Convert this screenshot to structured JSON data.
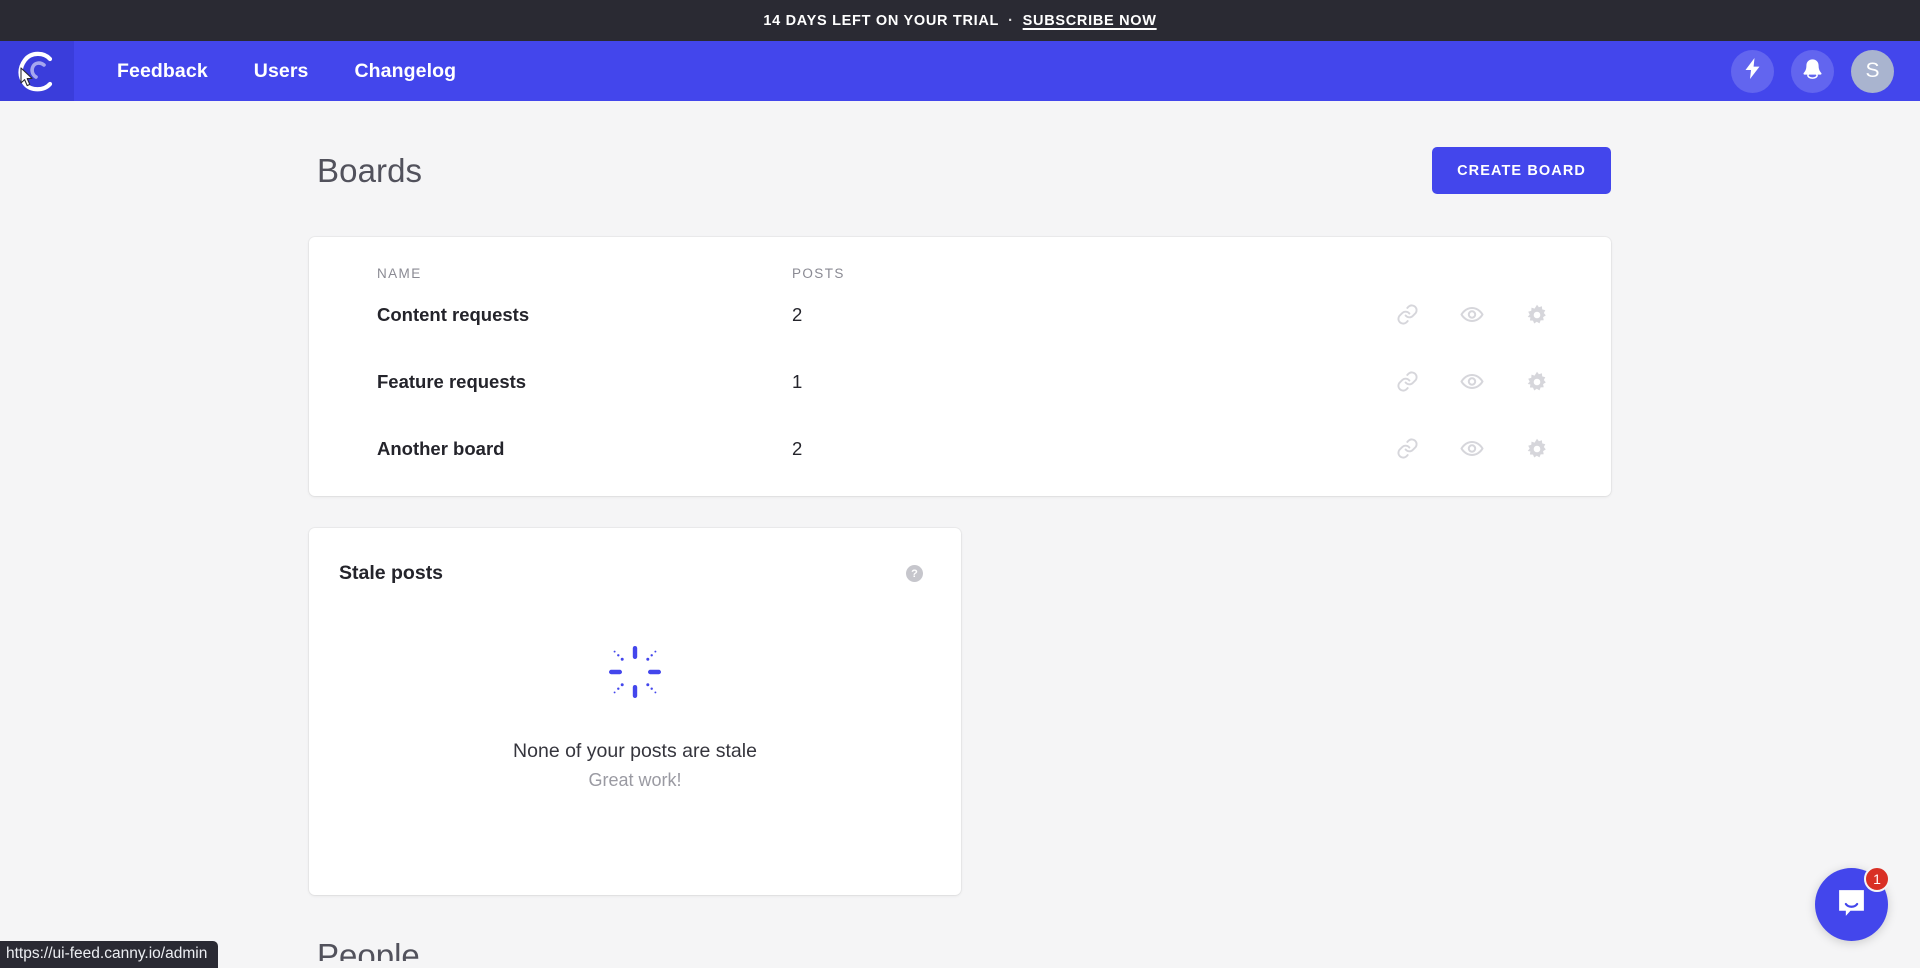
{
  "banner": {
    "trial_text": "14 DAYS LEFT ON YOUR TRIAL",
    "separator": "·",
    "subscribe_label": "SUBSCRIBE NOW"
  },
  "navbar": {
    "logo_name": "canny-logo",
    "links": [
      {
        "label": "Feedback"
      },
      {
        "label": "Users"
      },
      {
        "label": "Changelog"
      }
    ],
    "actions": [
      {
        "name": "lightning-icon"
      },
      {
        "name": "bell-icon"
      }
    ],
    "avatar_initial": "S"
  },
  "page": {
    "title": "Boards",
    "create_button_label": "CREATE BOARD"
  },
  "boards_table": {
    "columns": [
      "NAME",
      "POSTS"
    ],
    "rows": [
      {
        "name": "Content requests",
        "posts": "2"
      },
      {
        "name": "Feature requests",
        "posts": "1"
      },
      {
        "name": "Another board",
        "posts": "2"
      }
    ],
    "row_actions": [
      "link-icon",
      "eye-icon",
      "gear-icon"
    ]
  },
  "stale_posts": {
    "title": "Stale posts",
    "help_glyph": "?",
    "empty_primary": "None of your posts are stale",
    "empty_secondary": "Great work!"
  },
  "next_section": {
    "title": "People"
  },
  "status_bar": {
    "url": "https://ui-feed.canny.io/admin"
  },
  "intercom": {
    "badge_count": "1"
  },
  "colors": {
    "brand_purple": "#4346ec",
    "logo_block": "#3a3ddb",
    "banner_dark": "#2a2a33",
    "page_bg": "#f5f5f6",
    "badge_red": "#d93025",
    "avatar_bg": "#a9b4cf",
    "sparkle_purple": "#4346ec"
  }
}
